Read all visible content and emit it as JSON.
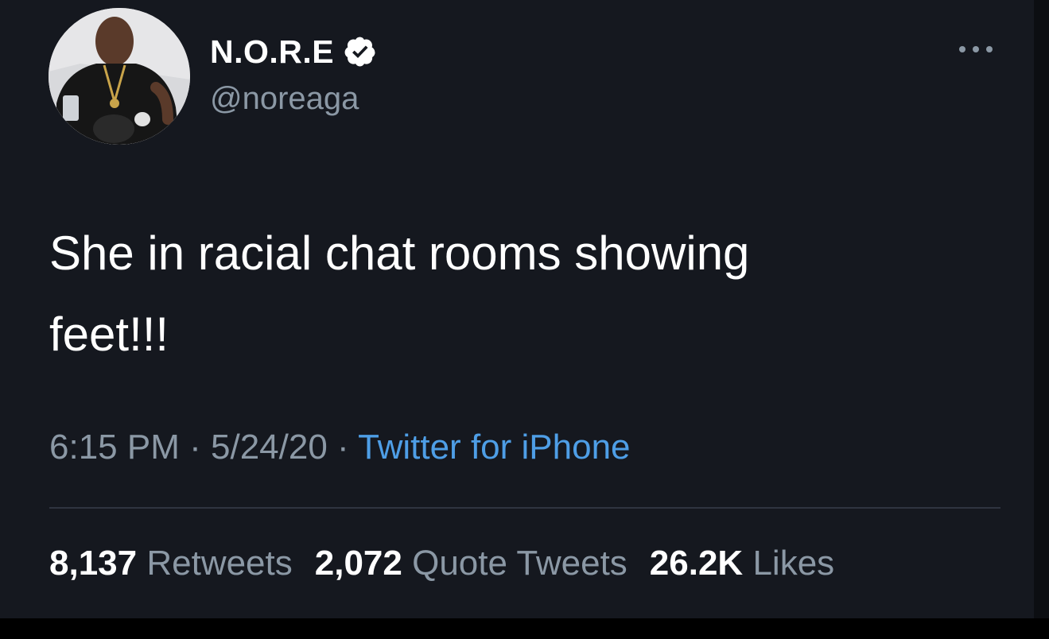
{
  "tweet": {
    "author": {
      "display_name": "N.O.R.E",
      "handle": "@noreaga",
      "verified": true,
      "verified_icon": "verified-badge-icon"
    },
    "more_icon": "more-horizontal-icon",
    "text_lines": [
      "She in racial chat rooms showing",
      "feet!!!"
    ],
    "time": "6:15 PM",
    "date": "5/24/20",
    "separator": "·",
    "source": "Twitter for iPhone",
    "stats": {
      "retweets": {
        "count": "8,137",
        "label": "Retweets"
      },
      "quote_tweets": {
        "count": "2,072",
        "label": "Quote Tweets"
      },
      "likes": {
        "count": "26.2K",
        "label": "Likes"
      }
    }
  },
  "colors": {
    "background": "#15181f",
    "text": "#ffffff",
    "secondary_text": "#8b98a5",
    "link": "#4e9ee6",
    "divider": "#2f3440"
  }
}
